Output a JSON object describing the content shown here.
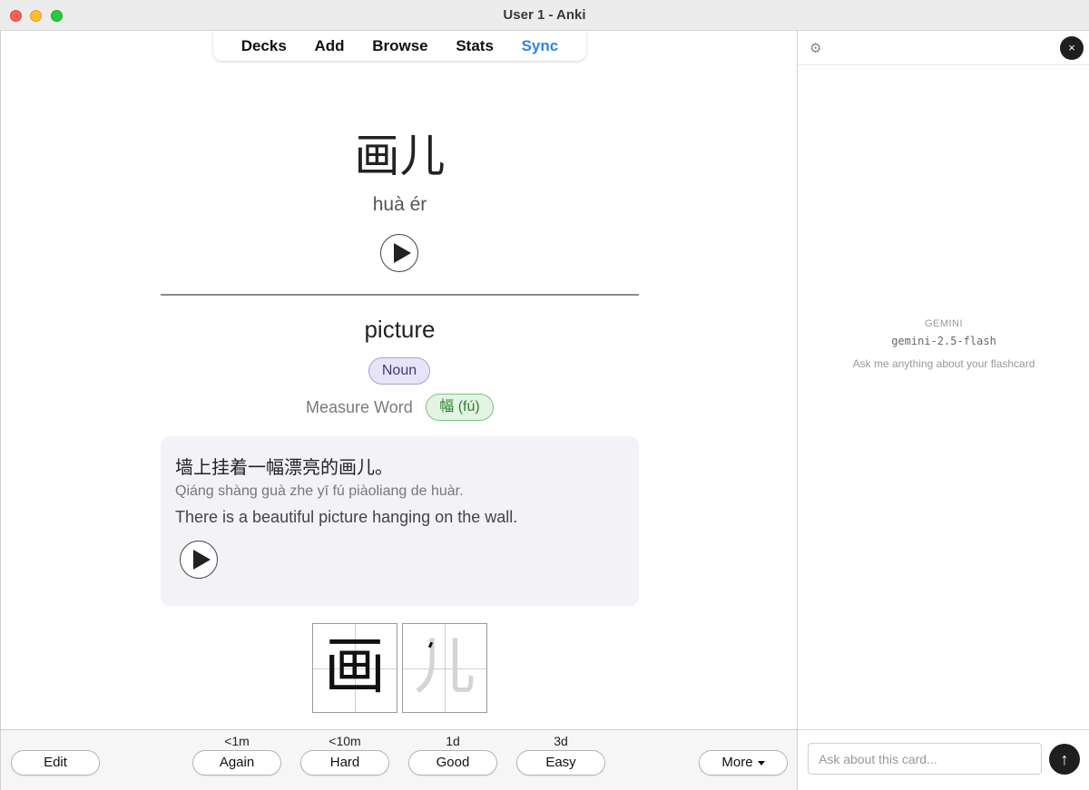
{
  "window": {
    "title": "User 1 - Anki"
  },
  "nav": {
    "decks": "Decks",
    "add": "Add",
    "browse": "Browse",
    "stats": "Stats",
    "sync": "Sync"
  },
  "card": {
    "hanzi": "画儿",
    "pinyin": "huà ér",
    "meaning": "picture",
    "part_of_speech": "Noun",
    "measure_word_label": "Measure Word",
    "measure_word": "幅 (fú)",
    "example": {
      "chinese": "墙上挂着一幅漂亮的画儿。",
      "pinyin": "Qiáng shàng guà zhe yī fú piàoliang de huàr.",
      "english": "There is a beautiful picture hanging on the wall."
    },
    "stroke_chars": [
      "画",
      "儿"
    ]
  },
  "review": {
    "edit": "Edit",
    "more": "More",
    "answers": [
      {
        "label": "Again",
        "interval": "<1m"
      },
      {
        "label": "Hard",
        "interval": "<10m"
      },
      {
        "label": "Good",
        "interval": "1d"
      },
      {
        "label": "Easy",
        "interval": "3d"
      }
    ]
  },
  "assistant": {
    "provider": "GEMINI",
    "model": "gemini-2.5-flash",
    "hint": "Ask me anything about your flashcard",
    "input_placeholder": "Ask about this card...",
    "close_symbol": "×",
    "send_symbol": "↑",
    "settings_icon": "gear-icon"
  },
  "colors": {
    "sync_link": "#2e83e6",
    "noun_badge_bg": "#e6e4f6",
    "measure_badge_bg": "#e4f4e4"
  }
}
